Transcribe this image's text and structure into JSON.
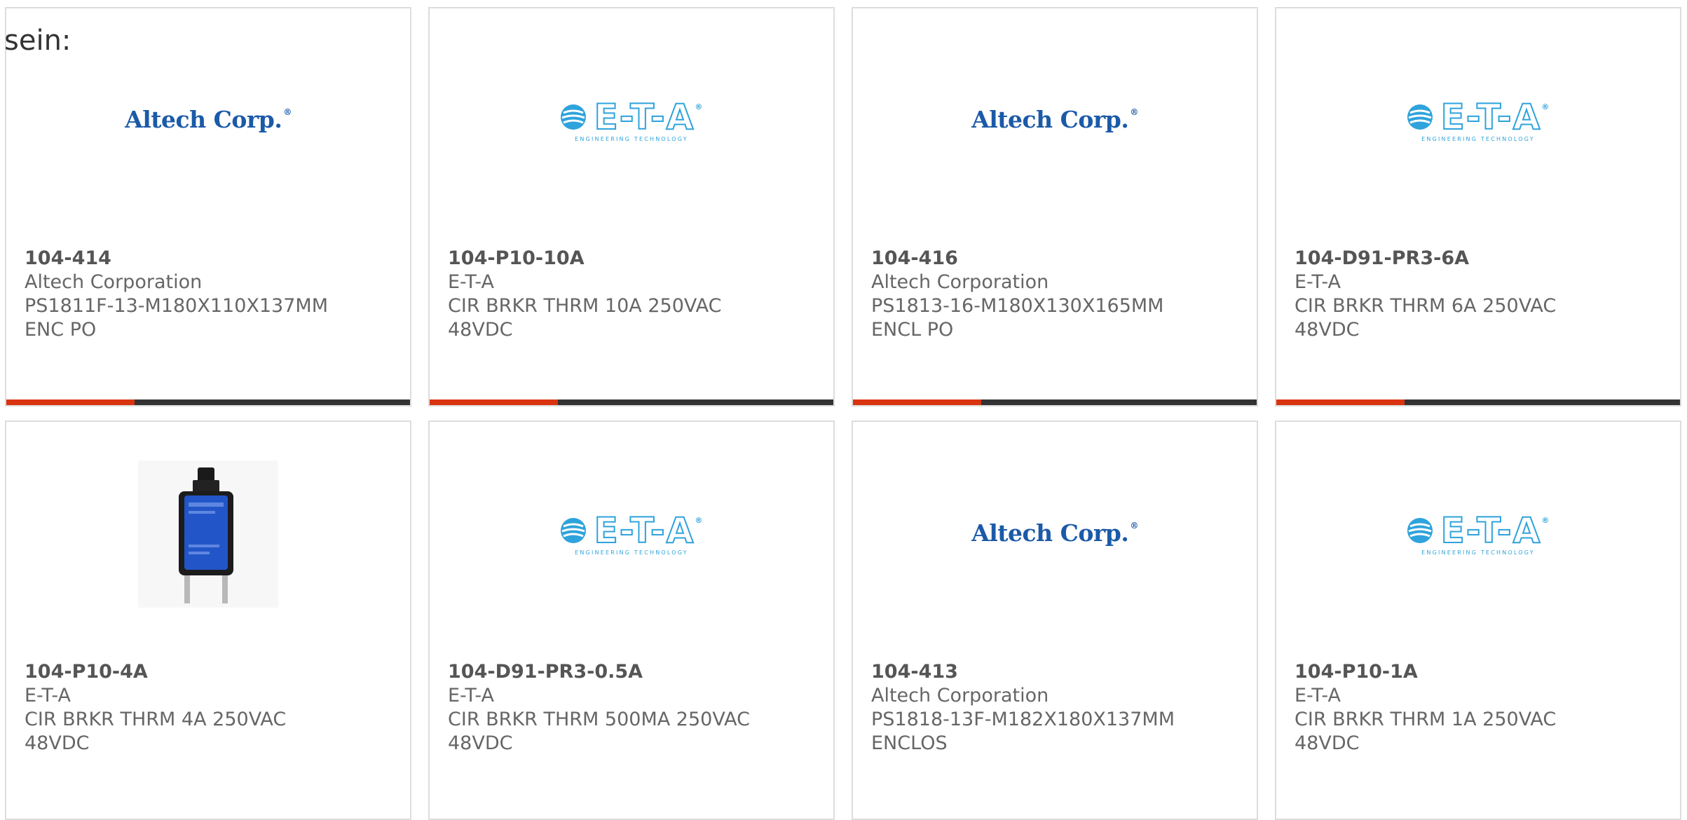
{
  "intro_text": "sein:",
  "logos": {
    "altech": "Altech Corp.",
    "altech_mark": "®",
    "eta": "E-T-A",
    "eta_mark": "®",
    "eta_tagline": "ENGINEERING TECHNOLOGY"
  },
  "colors": {
    "accent": "#d9340f",
    "bar": "#333333",
    "altech_blue": "#1b5aa8",
    "eta_blue": "#2ea3dc",
    "device_blue": "#2256c8"
  },
  "products": [
    {
      "part": "104-414",
      "maker": "Altech Corporation",
      "desc1": "PS1811F-13-M180X110X137MM",
      "desc2": "ENC PO",
      "image": "altech-logo"
    },
    {
      "part": "104-P10-10A",
      "maker": "E-T-A",
      "desc1": "CIR BRKR THRM 10A 250VAC",
      "desc2": "48VDC",
      "image": "eta-logo"
    },
    {
      "part": "104-416",
      "maker": "Altech Corporation",
      "desc1": "PS1813-16-M180X130X165MM",
      "desc2": "ENCL PO",
      "image": "altech-logo"
    },
    {
      "part": "104-D91-PR3-6A",
      "maker": "E-T-A",
      "desc1": "CIR BRKR THRM 6A 250VAC",
      "desc2": "48VDC",
      "image": "eta-logo"
    },
    {
      "part": "104-P10-4A",
      "maker": "E-T-A",
      "desc1": "CIR BRKR THRM 4A 250VAC",
      "desc2": "48VDC",
      "image": "breaker-photo"
    },
    {
      "part": "104-D91-PR3-0.5A",
      "maker": "E-T-A",
      "desc1": "CIR BRKR THRM 500MA 250VAC",
      "desc2": "48VDC",
      "image": "eta-logo"
    },
    {
      "part": "104-413",
      "maker": "Altech Corporation",
      "desc1": "PS1818-13F-M182X180X137MM",
      "desc2": "ENCLOS",
      "image": "altech-logo"
    },
    {
      "part": "104-P10-1A",
      "maker": "E-T-A",
      "desc1": "CIR BRKR THRM 1A 250VAC",
      "desc2": "48VDC",
      "image": "eta-logo"
    }
  ]
}
